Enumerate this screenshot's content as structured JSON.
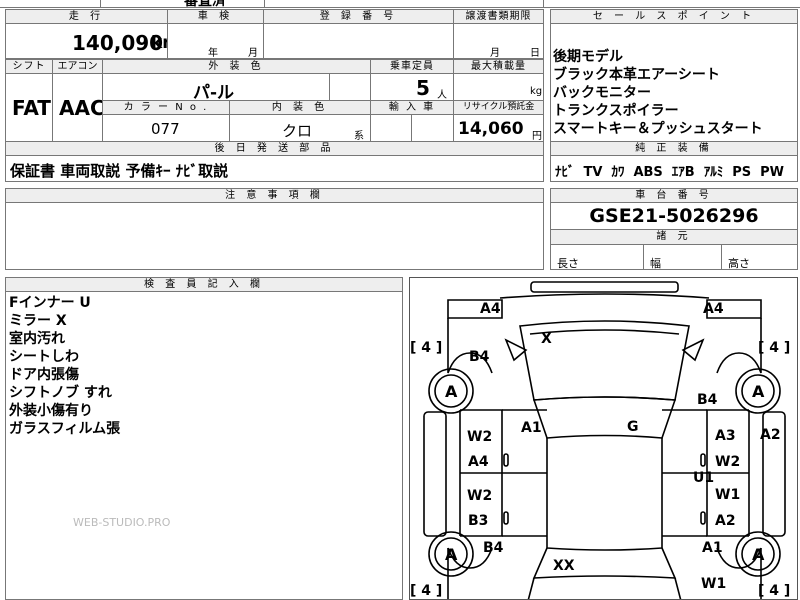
{
  "top_partial": "審査済",
  "mileage": {
    "header": "走 行",
    "value": "140,090",
    "unit": "km"
  },
  "inspection": {
    "header": "車 検",
    "year_unit": "年",
    "month_unit": "月"
  },
  "registration": {
    "header": "登 録 番 号",
    "value": ""
  },
  "transfer": {
    "header": "譲渡書類期限",
    "month_unit": "月",
    "day_unit": "日"
  },
  "shift": {
    "header": "シフト",
    "value": "FAT"
  },
  "aircon": {
    "header": "エアコン",
    "value": "AAC"
  },
  "exterior": {
    "header": "外 装 色",
    "value": "パ-ル"
  },
  "capacity": {
    "header": "乗車定員",
    "value": "5",
    "unit": "人"
  },
  "max_load": {
    "header": "最大積載量",
    "value": "",
    "unit": "kg"
  },
  "color_no": {
    "header": "カ ラ ー N o .",
    "value": "077"
  },
  "interior": {
    "header": "内 装 色",
    "value": "クロ",
    "suffix": "系"
  },
  "import": {
    "header": "輸 入 車",
    "value": ""
  },
  "recycle": {
    "header": "リサイクル預託金",
    "value": "14,060",
    "unit": "円"
  },
  "parts": {
    "header": "後 日 発 送 部 品",
    "value": "保証書 車両取説 予備ｷｰ ﾅﾋﾞ取説"
  },
  "notes": {
    "header": "注 意 事 項 欄",
    "value": ""
  },
  "sales_points": {
    "header": "セ ー ル ス ポ イ ン ト",
    "items": [
      "後期モデル",
      "ブラック本革エアーシート",
      "バックモニター",
      "トランクスポイラー",
      "スマートキー＆プッシュスタート"
    ]
  },
  "equipment": {
    "header": "純 正 装 備",
    "items": [
      "ﾅﾋﾞ",
      "TV",
      "ｶﾜ",
      "ABS",
      "ｴｱB",
      "ｱﾙﾐ",
      "PS",
      "PW"
    ]
  },
  "chassis": {
    "header": "車 台 番 号",
    "value": "GSE21-5026296"
  },
  "specs": {
    "header": "諸 元",
    "length": "長さ",
    "width": "幅",
    "height": "高さ"
  },
  "inspector": {
    "header": "検 査 員 記 入 欄",
    "lines": [
      "Fインナー U",
      "ミラー X",
      "室内汚れ",
      "シートしわ",
      "ドア内張傷",
      "シフトノブ すれ",
      "外装小傷有り",
      "ガラスフィルム張"
    ]
  },
  "watermark": "WEB-STUDIO.PRO",
  "diagram": {
    "bracket_tl": "[ 4 ]",
    "bracket_tr": "[ 4 ]",
    "bracket_bl": "[ 4 ]",
    "bracket_br": "[ 4 ]",
    "tire_fl": "A",
    "tire_fr": "A",
    "tire_rl": "A",
    "tire_rr": "A",
    "labels": {
      "a4_tl": "A4",
      "a4_tr": "A4",
      "x": "X",
      "b4_fl": "B4",
      "b4_fr": "B4",
      "a1_c": "A1",
      "g": "G",
      "w2_l1": "W2",
      "a4_l": "A4",
      "a3_r": "A3",
      "a2_r": "A2",
      "w2_r": "W2",
      "u1": "U1",
      "w2_l2": "W2",
      "w1_r1": "W1",
      "b3_l": "B3",
      "a2_r2": "A2",
      "b4_rl": "B4",
      "a1_rr": "A1",
      "xx": "XX",
      "w1_r2": "W1"
    }
  }
}
